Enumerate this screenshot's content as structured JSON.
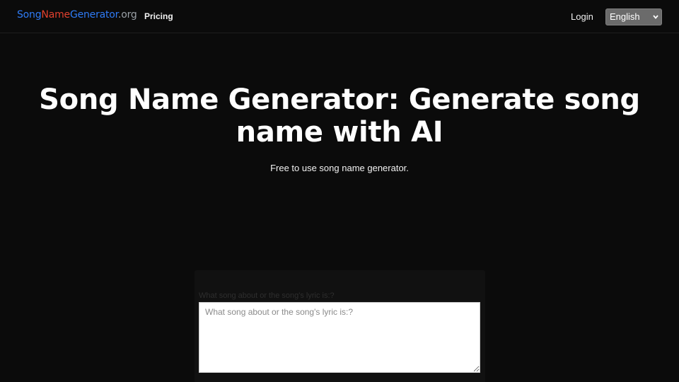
{
  "header": {
    "logo": {
      "part1": "Song",
      "part2": "Name",
      "part3": "Generator",
      "part4": ".org"
    },
    "nav": {
      "pricing_label": "Pricing"
    },
    "login_label": "Login",
    "language": {
      "selected": "English"
    }
  },
  "hero": {
    "title": "Song Name Generator: Generate song name with AI",
    "subtitle": "Free to use song name generator."
  },
  "form": {
    "field_label": "What song about or the song's lyric is:?",
    "textarea_placeholder": "What song about or the song's lyric is:?"
  },
  "colors": {
    "background": "#0b0b0b",
    "logo_blue": "#2f7bf5",
    "logo_red": "#e2412f",
    "logo_gray": "#9aa0a6",
    "select_bg": "#6b6b6b"
  },
  "icons": {
    "language_select": "chevron-down-icon"
  }
}
